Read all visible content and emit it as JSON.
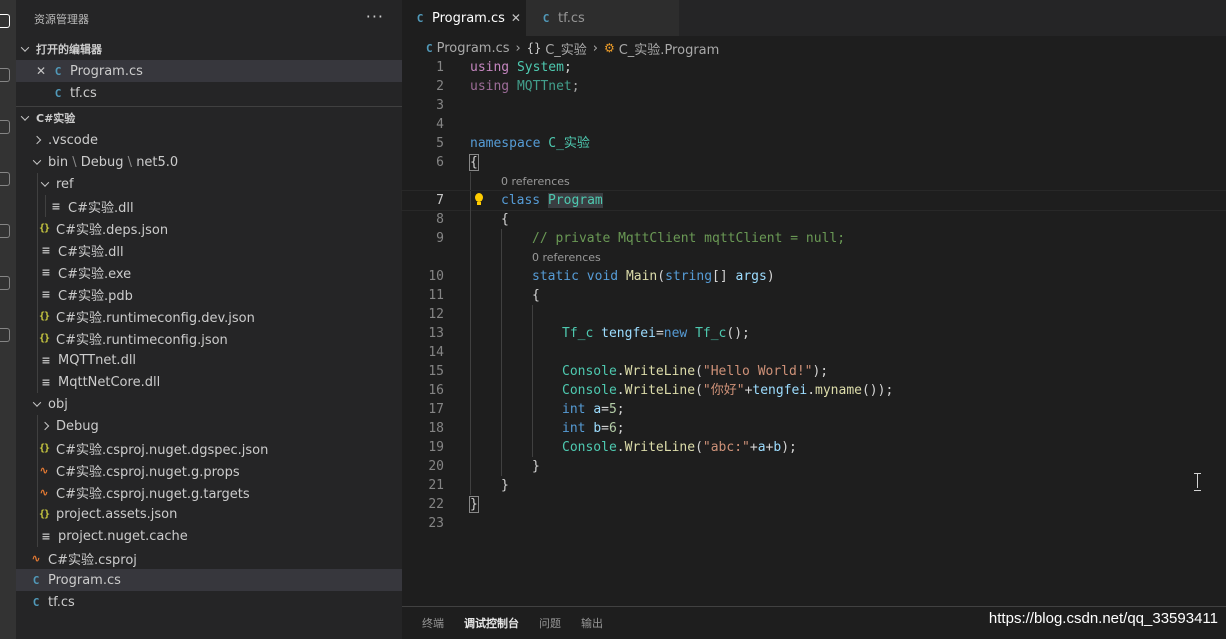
{
  "explorer": {
    "title": "资源管理器",
    "more": "···",
    "open_editors_label": "打开的编辑器",
    "open_editors": [
      {
        "name": "Program.cs",
        "icon": "csharp-icon"
      },
      {
        "name": "tf.cs",
        "icon": "csharp-icon"
      }
    ],
    "folder_label": "C#实验",
    "tree": [
      {
        "name": ".vscode",
        "kind": "folder",
        "state": "closed"
      },
      {
        "name": "bin",
        "kind": "folder",
        "state": "open",
        "path_tail": "Debug",
        "path_tail2": "net5.0"
      },
      {
        "name": "ref",
        "kind": "folder",
        "state": "open"
      },
      {
        "name": "C#实验.dll",
        "kind": "file",
        "icon": "lines-icon"
      },
      {
        "name": "C#实验.deps.json",
        "kind": "file",
        "icon": "json-icon"
      },
      {
        "name": "C#实验.dll",
        "kind": "file",
        "icon": "lines-icon"
      },
      {
        "name": "C#实验.exe",
        "kind": "file",
        "icon": "lines-icon"
      },
      {
        "name": "C#实验.pdb",
        "kind": "file",
        "icon": "lines-icon"
      },
      {
        "name": "C#实验.runtimeconfig.dev.json",
        "kind": "file",
        "icon": "json-icon"
      },
      {
        "name": "C#实验.runtimeconfig.json",
        "kind": "file",
        "icon": "json-icon"
      },
      {
        "name": "MQTTnet.dll",
        "kind": "file",
        "icon": "lines-icon"
      },
      {
        "name": "MqttNetCore.dll",
        "kind": "file",
        "icon": "lines-icon"
      },
      {
        "name": "obj",
        "kind": "folder",
        "state": "open"
      },
      {
        "name": "Debug",
        "kind": "folder",
        "state": "closed"
      },
      {
        "name": "C#实验.csproj.nuget.dgspec.json",
        "kind": "file",
        "icon": "json-icon"
      },
      {
        "name": "C#实验.csproj.nuget.g.props",
        "kind": "file",
        "icon": "rss-icon"
      },
      {
        "name": "C#实验.csproj.nuget.g.targets",
        "kind": "file",
        "icon": "rss-icon"
      },
      {
        "name": "project.assets.json",
        "kind": "file",
        "icon": "json-icon"
      },
      {
        "name": "project.nuget.cache",
        "kind": "file",
        "icon": "lines-icon"
      },
      {
        "name": "C#实验.csproj",
        "kind": "file",
        "icon": "rss-icon"
      },
      {
        "name": "Program.cs",
        "kind": "file",
        "icon": "csharp-icon"
      },
      {
        "name": "tf.cs",
        "kind": "file",
        "icon": "csharp-icon"
      }
    ]
  },
  "tabs": [
    {
      "label": "Program.cs",
      "icon": "csharp-icon",
      "active": true,
      "close": "✕"
    },
    {
      "label": "tf.cs",
      "icon": "csharp-icon",
      "active": false
    }
  ],
  "breadcrumb": {
    "file": "Program.cs",
    "namespace": "C_实验",
    "class": "C_实验.Program"
  },
  "code": {
    "lens1": "0 references",
    "lens2": "0 references",
    "lines": [
      {
        "n": "1"
      },
      {
        "n": "2"
      },
      {
        "n": "3"
      },
      {
        "n": "4"
      },
      {
        "n": "5"
      },
      {
        "n": "6"
      },
      {
        "n": "7"
      },
      {
        "n": "8"
      },
      {
        "n": "9"
      },
      {
        "n": "10"
      },
      {
        "n": "11"
      },
      {
        "n": "12"
      },
      {
        "n": "13"
      },
      {
        "n": "14"
      },
      {
        "n": "15"
      },
      {
        "n": "16"
      },
      {
        "n": "17"
      },
      {
        "n": "18"
      },
      {
        "n": "19"
      },
      {
        "n": "20"
      },
      {
        "n": "21"
      },
      {
        "n": "22"
      },
      {
        "n": "23"
      }
    ],
    "tokens": {
      "using": "using",
      "system": "System",
      "mqttnet": "MQTTnet",
      "namespace": "namespace",
      "ns_name": "C_实验",
      "class": "class",
      "program": "Program",
      "comment": "// private MqttClient mqttClient = null;",
      "static": "static",
      "void": "void",
      "main": "Main",
      "string": "string",
      "args": "args",
      "tfc": "Tf_c",
      "tengfei": "tengfei",
      "new": "new",
      "console": "Console",
      "writeline": "WriteLine",
      "hello": "\"Hello World!\"",
      "nihao": "\"你好\"",
      "myname": "myname",
      "int": "int",
      "a": "a",
      "b": "b",
      "five": "5",
      "six": "6",
      "abc": "\"abc:\""
    }
  },
  "panel": {
    "tabs": [
      "终端",
      "调试控制台",
      "问题",
      "输出"
    ],
    "active": "调试控制台"
  },
  "watermark": "https://blog.csdn.net/qq_33593411",
  "colors": {
    "keyword": "#569cd6",
    "control_keyword": "#c586c0",
    "type": "#4ec9b0",
    "function": "#dcdcaa",
    "string": "#ce9178",
    "number": "#b5cea8",
    "comment": "#6a9955",
    "variable": "#9cdcfe",
    "csharp_icon": "#519aba",
    "json_icon": "#cbcb41",
    "rss_icon": "#e37933"
  }
}
